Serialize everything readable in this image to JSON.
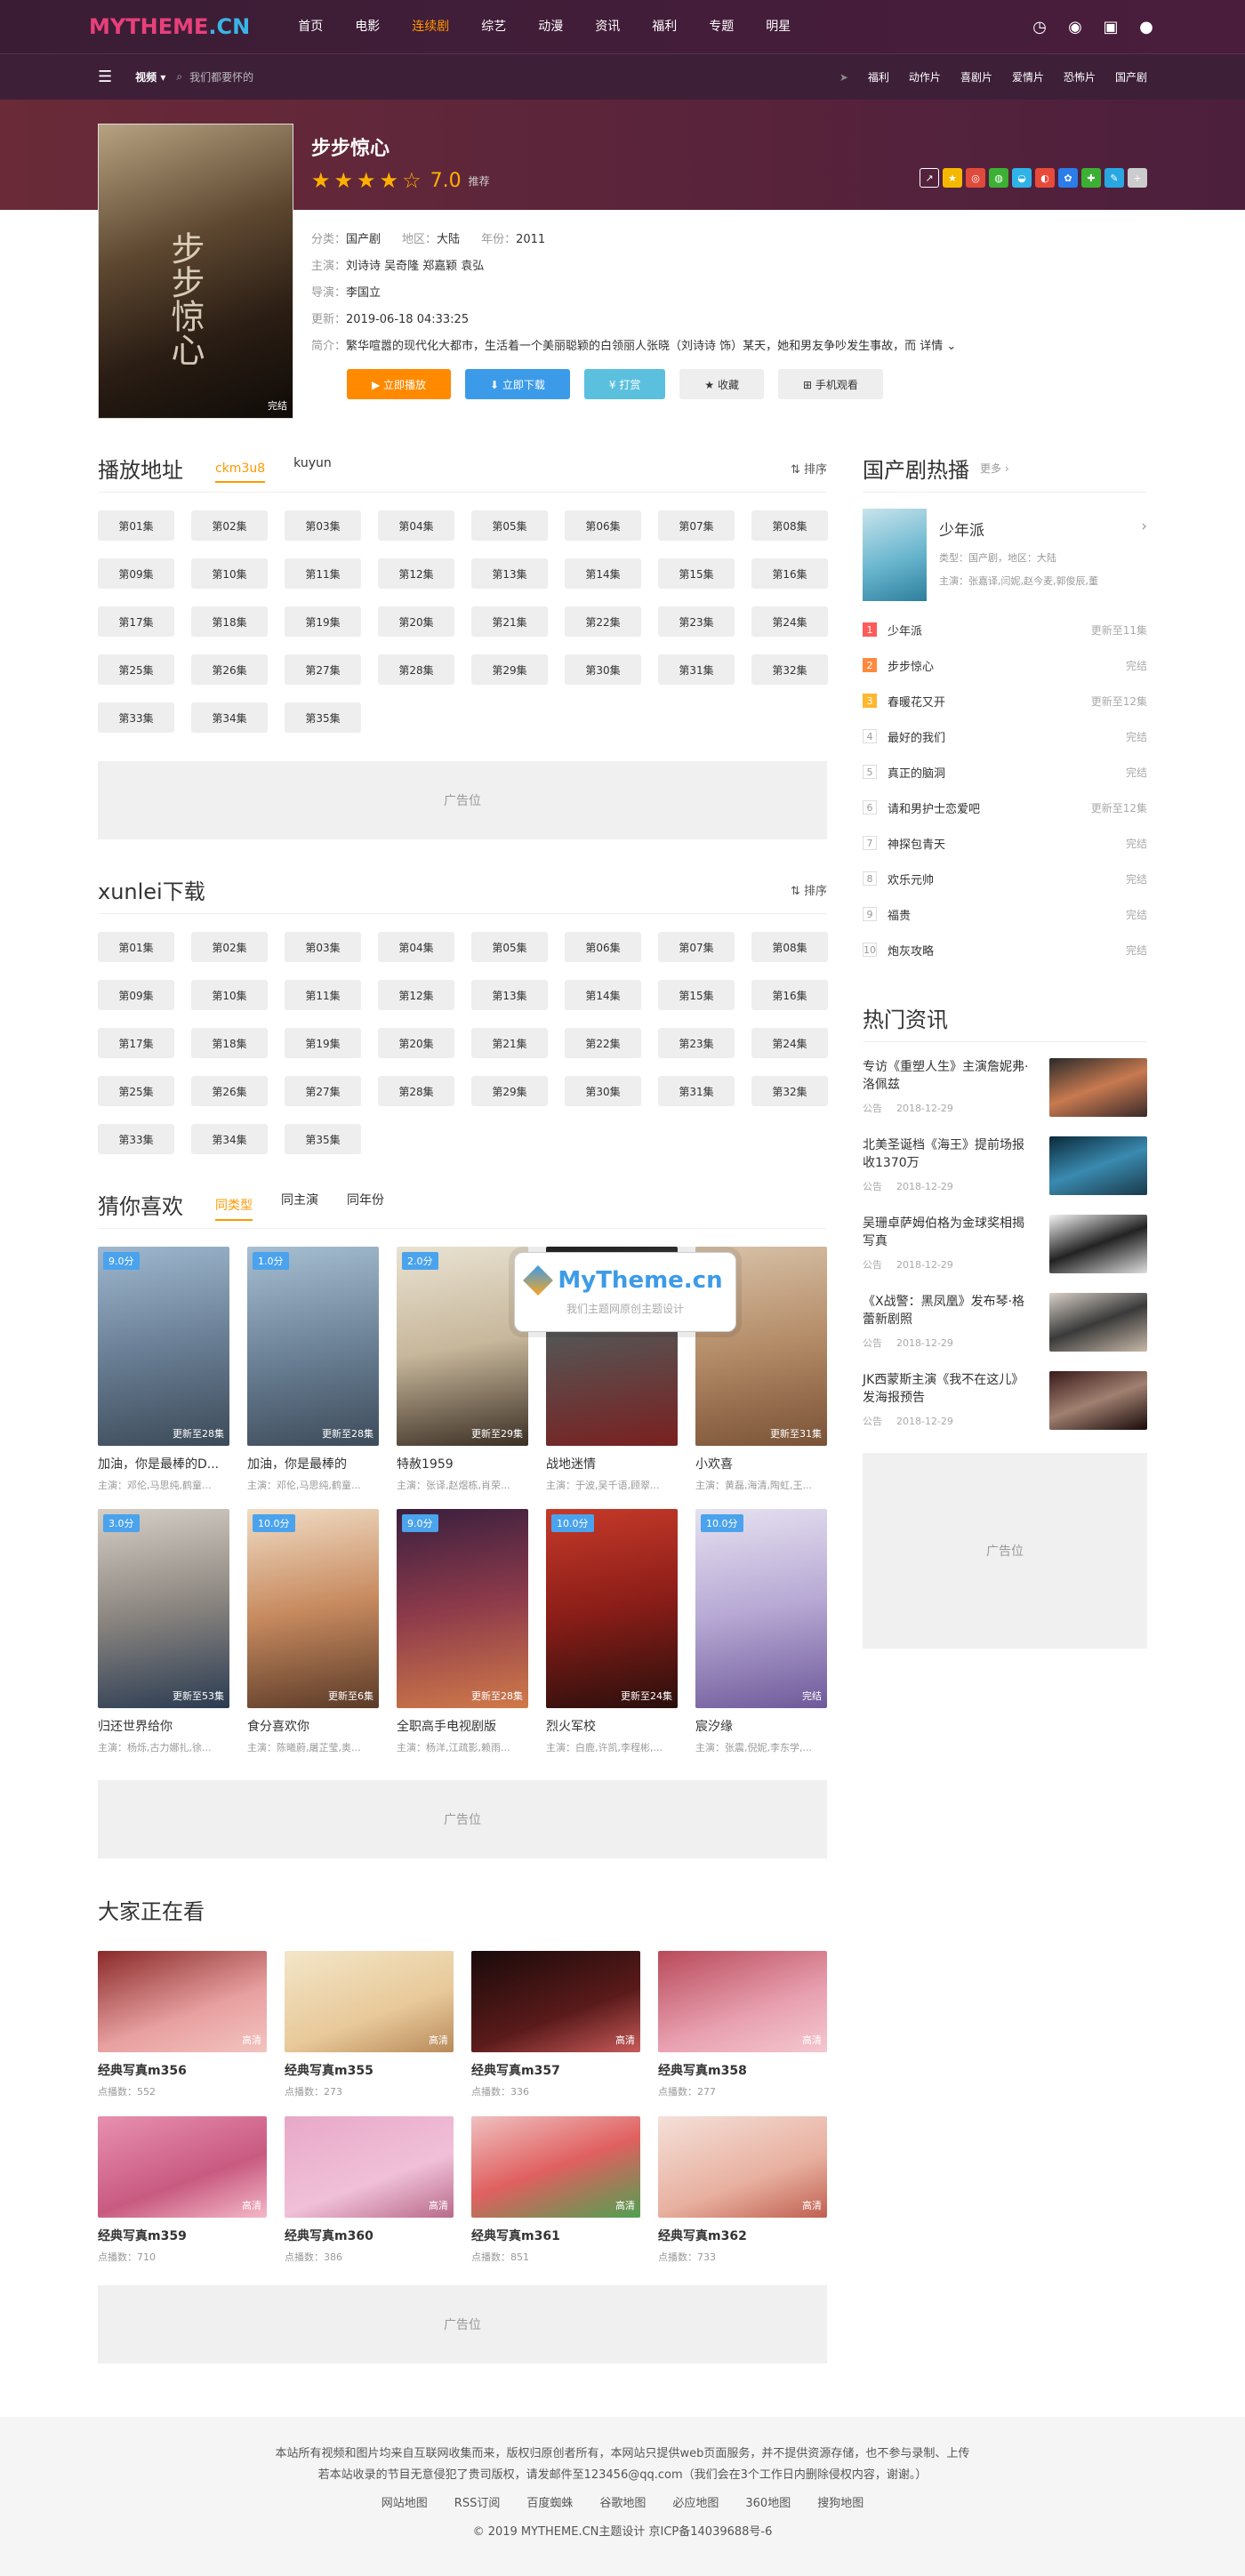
{
  "site": {
    "logo_a": "MYTHEME",
    "logo_b": ".CN"
  },
  "nav": [
    "首页",
    "电影",
    "连续剧",
    "综艺",
    "动漫",
    "资讯",
    "福利",
    "专题",
    "明星"
  ],
  "sub": {
    "channel": "视频",
    "search_placeholder": "我们都要怀的",
    "links": [
      "福利",
      "动作片",
      "喜剧片",
      "爱情片",
      "恐怖片",
      "国产剧"
    ]
  },
  "detail": {
    "title": "步步惊心",
    "score": "7.0",
    "rec": "推荐",
    "poster_tag": "完结",
    "cat_k": "分类：",
    "cat": "国产剧",
    "area_k": "地区：",
    "area": "大陆",
    "year_k": "年份：",
    "year": "2011",
    "actor_k": "主演：",
    "actor": "刘诗诗 吴奇隆 郑嘉颖 袁弘",
    "dir_k": "导演：",
    "dir": "李国立",
    "upd_k": "更新：",
    "upd": "2019-06-18 04:33:25",
    "intro_k": "简介：",
    "intro": "繁华喧嚣的现代化大都市，生活着一个美丽聪颖的白领丽人张晓（刘诗诗 饰）某天，她和男友争吵发生事故，而 详情 ⌄",
    "buttons": [
      "▶ 立即播放",
      "⬇ 立即下载",
      "¥ 打赏",
      "★ 收藏",
      "⊞ 手机观看"
    ]
  },
  "play": {
    "title": "播放地址",
    "tabs": [
      "ckm3u8",
      "kuyun"
    ],
    "sort": "排序"
  },
  "xunlei": {
    "title": "xunlei下载",
    "sort": "排序"
  },
  "episodes": [
    "第01集",
    "第02集",
    "第03集",
    "第04集",
    "第05集",
    "第06集",
    "第07集",
    "第08集",
    "第09集",
    "第10集",
    "第11集",
    "第12集",
    "第13集",
    "第14集",
    "第15集",
    "第16集",
    "第17集",
    "第18集",
    "第19集",
    "第20集",
    "第21集",
    "第22集",
    "第23集",
    "第24集",
    "第25集",
    "第26集",
    "第27集",
    "第28集",
    "第29集",
    "第30集",
    "第31集",
    "第32集",
    "第33集",
    "第34集",
    "第35集"
  ],
  "ad": "广告位",
  "guess": {
    "title": "猜你喜欢",
    "tabs": [
      "同类型",
      "同主演",
      "同年份"
    ],
    "items": [
      {
        "badge": "9.0分",
        "st": "更新至28集",
        "name": "加油，你是最棒的D...",
        "actor": "主演：邓伦,马思纯,鹤童..."
      },
      {
        "badge": "1.0分",
        "st": "更新至28集",
        "name": "加油，你是最棒的",
        "actor": "主演：邓伦,马思纯,鹤童..."
      },
      {
        "badge": "2.0分",
        "st": "更新至29集",
        "name": "特赦1959",
        "actor": "主演：张译,赵煜栋,肖荣..."
      },
      {
        "badge": "",
        "st": "",
        "name": "战地迷情",
        "actor": "主演：于波,吴千语,顾翠..."
      },
      {
        "badge": "",
        "st": "更新至31集",
        "name": "小欢喜",
        "actor": "主演：黄磊,海清,陶虹,王..."
      },
      {
        "badge": "3.0分",
        "st": "更新至53集",
        "name": "归还世界给你",
        "actor": "主演：杨烁,古力娜扎,徐..."
      },
      {
        "badge": "10.0分",
        "st": "更新至6集",
        "name": "食分喜欢你",
        "actor": "主演：陈曦蔚,屠芷莹,奥..."
      },
      {
        "badge": "9.0分",
        "st": "更新至28集",
        "name": "全职高手电视剧版",
        "actor": "主演：杨洋,江疏影,赖雨..."
      },
      {
        "badge": "10.0分",
        "st": "更新至24集",
        "name": "烈火军校",
        "actor": "主演：白鹿,许凯,李程彬,..."
      },
      {
        "badge": "10.0分",
        "st": "完结",
        "name": "宸汐缘",
        "actor": "主演：张震,倪妮,李东学,..."
      }
    ]
  },
  "watermark": {
    "t": "MyTheme.cn",
    "s": "我们主题网原创主题设计"
  },
  "watching": {
    "title": "大家正在看",
    "items": [
      {
        "name": "经典写真m356",
        "views": "点播数：552",
        "hd": "高清"
      },
      {
        "name": "经典写真m355",
        "views": "点播数：273",
        "hd": "高清"
      },
      {
        "name": "经典写真m357",
        "views": "点播数：336",
        "hd": "高清"
      },
      {
        "name": "经典写真m358",
        "views": "点播数：277",
        "hd": "高清"
      },
      {
        "name": "经典写真m359",
        "views": "点播数：710",
        "hd": "高清"
      },
      {
        "name": "经典写真m360",
        "views": "点播数：386",
        "hd": "高清"
      },
      {
        "name": "经典写真m361",
        "views": "点播数：851",
        "hd": "高清"
      },
      {
        "name": "经典写真m362",
        "views": "点播数：733",
        "hd": "高清"
      }
    ]
  },
  "hot": {
    "title": "国产剧热播",
    "more": "更多 ›",
    "feature_title": "少年派",
    "feature_type": "类型：国产剧，地区：大陆",
    "feature_actor": "主演：张嘉译,闫妮,赵今麦,郭俊辰,董",
    "list": [
      {
        "n": "1",
        "name": "少年派",
        "s": "更新至11集"
      },
      {
        "n": "2",
        "name": "步步惊心",
        "s": "完结"
      },
      {
        "n": "3",
        "name": "春暖花又开",
        "s": "更新至12集"
      },
      {
        "n": "4",
        "name": "最好的我们",
        "s": "完结"
      },
      {
        "n": "5",
        "name": "真正的脑洞",
        "s": "完结"
      },
      {
        "n": "6",
        "name": "请和男护士恋爱吧",
        "s": "更新至12集"
      },
      {
        "n": "7",
        "name": "神探包青天",
        "s": "完结"
      },
      {
        "n": "8",
        "name": "欢乐元帅",
        "s": "完结"
      },
      {
        "n": "9",
        "name": "福贵",
        "s": "完结"
      },
      {
        "n": "10",
        "name": "炮灰攻略",
        "s": "完结"
      }
    ]
  },
  "news": {
    "title": "热门资讯",
    "items": [
      {
        "t": "专访《重塑人生》主演詹妮弗·洛佩兹",
        "tag": "公告",
        "d": "2018-12-29"
      },
      {
        "t": "北美圣诞档《海王》提前场报收1370万",
        "tag": "公告",
        "d": "2018-12-29"
      },
      {
        "t": "吴珊卓萨姆伯格为金球奖相揭写真",
        "tag": "公告",
        "d": "2018-12-29"
      },
      {
        "t": "《X战警：黑凤凰》发布琴·格蕾新剧照",
        "tag": "公告",
        "d": "2018-12-29"
      },
      {
        "t": "JK西蒙斯主演《我不在这儿》发海报预告",
        "tag": "公告",
        "d": "2018-12-29"
      }
    ]
  },
  "footer": {
    "l1": "本站所有视频和图片均来自互联网收集而来，版权归原创者所有，本网站只提供web页面服务，并不提供资源存储，也不参与录制、上传",
    "l2": "若本站收录的节目无意侵犯了贵司版权，请发邮件至123456@qq.com（我们会在3个工作日内删除侵权内容，谢谢。）",
    "links": [
      "网站地图",
      "RSS订阅",
      "百度蜘蛛",
      "谷歌地图",
      "必应地图",
      "360地图",
      "搜狗地图"
    ],
    "copy": "© 2019 MYTHEME.CN主题设计 京ICP备14039688号-6"
  }
}
